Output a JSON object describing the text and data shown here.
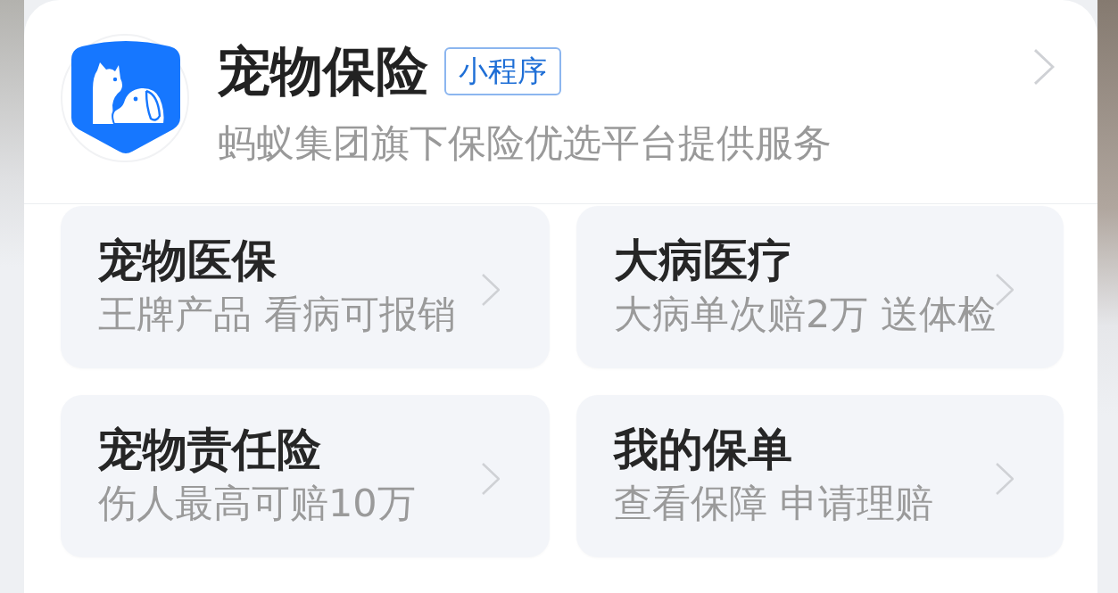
{
  "app": {
    "title": "宠物保险",
    "tag": "小程序",
    "subtitle": "蚂蚁集团旗下保险优选平台提供服务"
  },
  "cards": [
    {
      "title": "宠物医保",
      "subtitle": "王牌产品 看病可报销"
    },
    {
      "title": "大病医疗",
      "subtitle": "大病单次赔2万 送体检"
    },
    {
      "title": "宠物责任险",
      "subtitle": "伤人最高可赔10万"
    },
    {
      "title": "我的保单",
      "subtitle": "查看保障 申请理赔"
    }
  ]
}
